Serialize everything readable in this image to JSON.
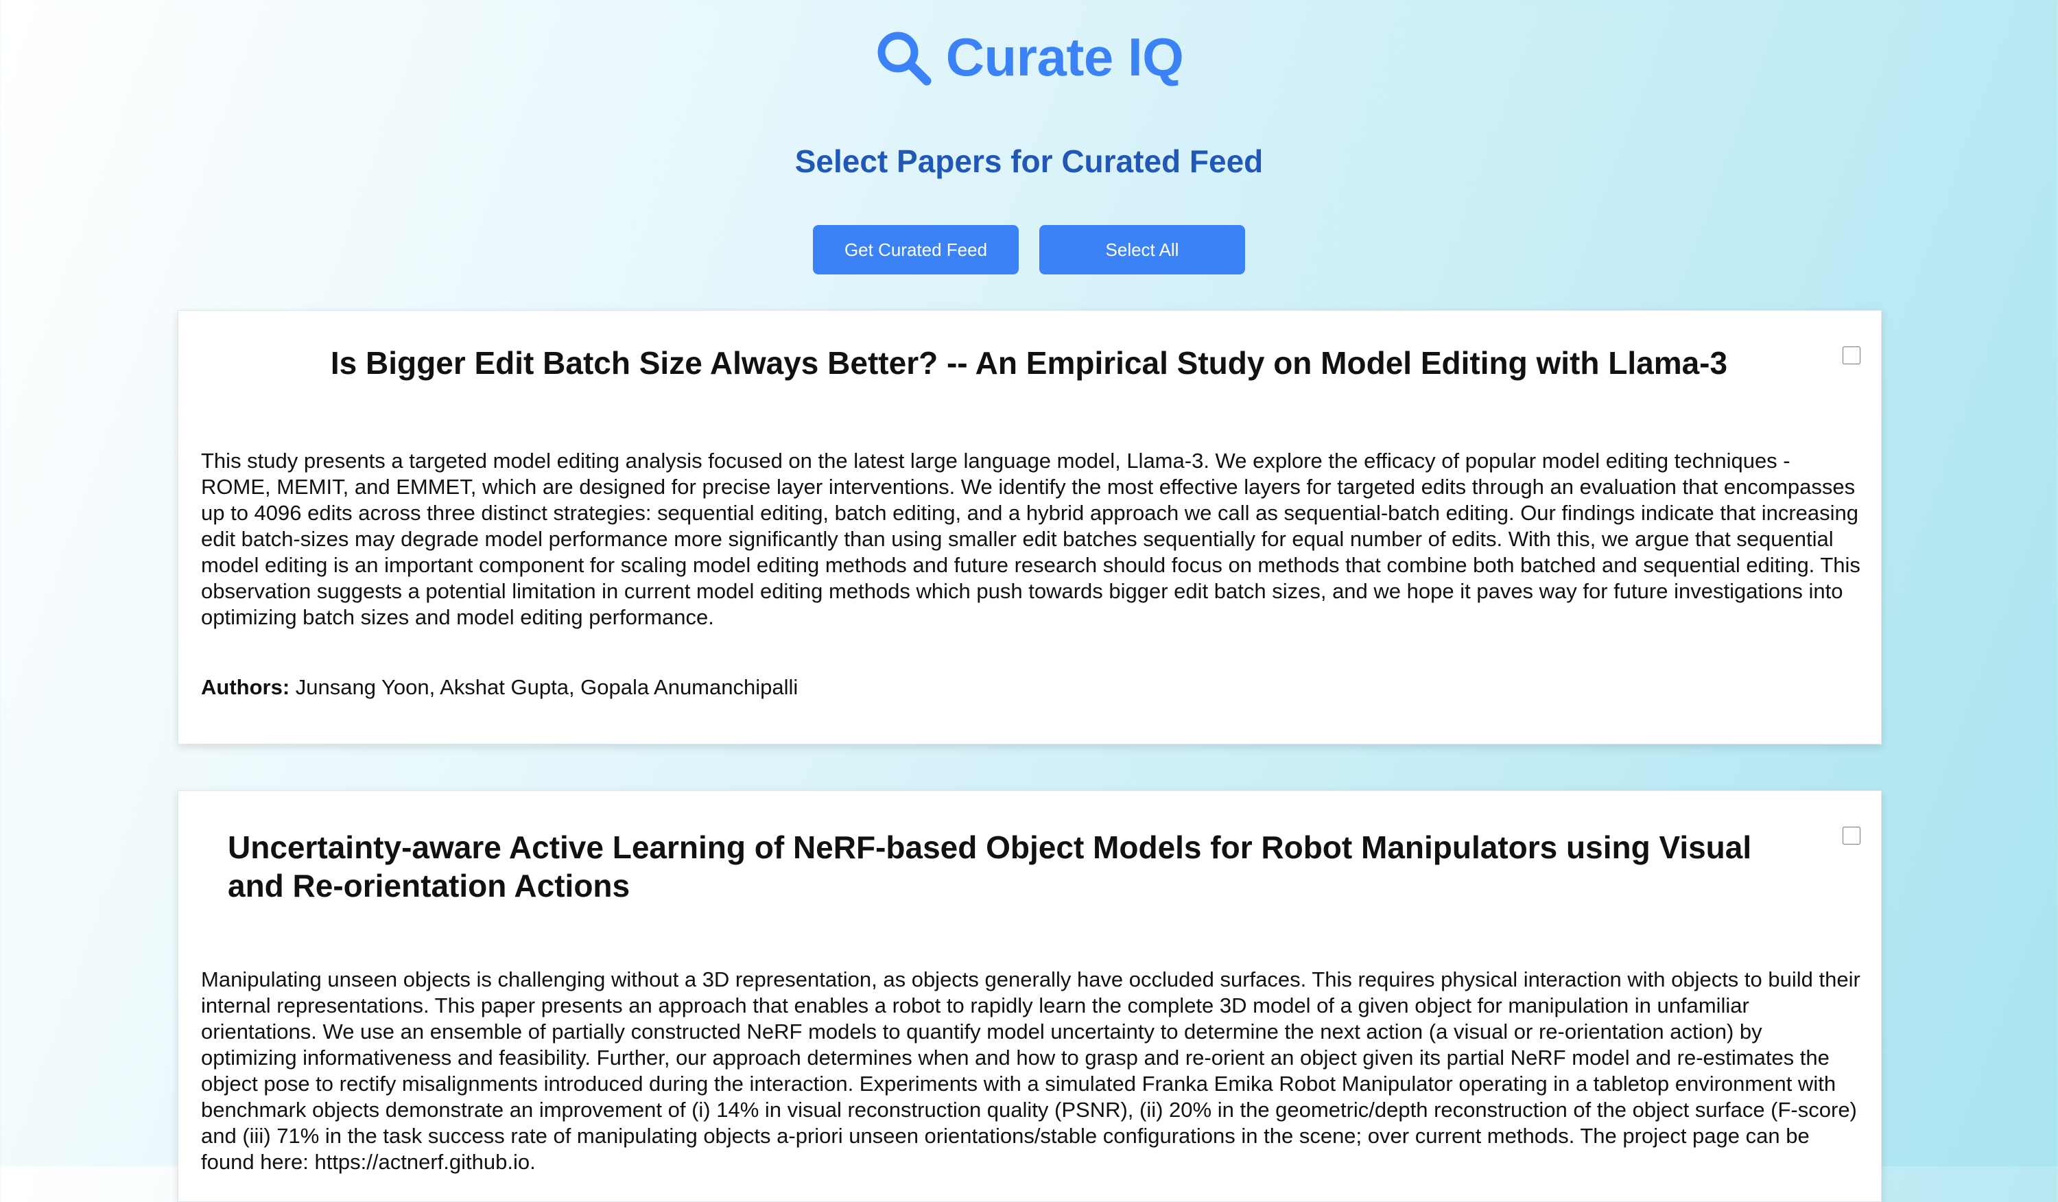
{
  "app": {
    "title": "Curate IQ",
    "logo_icon": "search-icon",
    "accent_color": "#3b82f6"
  },
  "page": {
    "heading": "Select Papers for Curated Feed"
  },
  "actions": {
    "get_feed_label": "Get Curated Feed",
    "select_all_label": "Select All"
  },
  "papers": [
    {
      "title": "Is Bigger Edit Batch Size Always Better? -- An Empirical Study on Model Editing with Llama-3",
      "abstract": "This study presents a targeted model editing analysis focused on the latest large language model, Llama-3. We explore the efficacy of popular model editing techniques - ROME, MEMIT, and EMMET, which are designed for precise layer interventions. We identify the most effective layers for targeted edits through an evaluation that encompasses up to 4096 edits across three distinct strategies: sequential editing, batch editing, and a hybrid approach we call as sequential-batch editing. Our findings indicate that increasing edit batch-sizes may degrade model performance more significantly than using smaller edit batches sequentially for equal number of edits. With this, we argue that sequential model editing is an important component for scaling model editing methods and future research should focus on methods that combine both batched and sequential editing. This observation suggests a potential limitation in current model editing methods which push towards bigger edit batch sizes, and we hope it paves way for future investigations into optimizing batch sizes and model editing performance.",
      "authors_label": "Authors:",
      "authors": "Junsang Yoon, Akshat Gupta, Gopala Anumanchipalli",
      "selected": false
    },
    {
      "title": "Uncertainty-aware Active Learning of NeRF-based Object Models for Robot Manipulators using Visual and Re-orientation Actions",
      "abstract": "Manipulating unseen objects is challenging without a 3D representation, as objects generally have occluded surfaces. This requires physical interaction with objects to build their internal representations. This paper presents an approach that enables a robot to rapidly learn the complete 3D model of a given object for manipulation in unfamiliar orientations. We use an ensemble of partially constructed NeRF models to quantify model uncertainty to determine the next action (a visual or re-orientation action) by optimizing informativeness and feasibility. Further, our approach determines when and how to grasp and re-orient an object given its partial NeRF model and re-estimates the object pose to rectify misalignments introduced during the interaction. Experiments with a simulated Franka Emika Robot Manipulator operating in a tabletop environment with benchmark objects demonstrate an improvement of (i) 14% in visual reconstruction quality (PSNR), (ii) 20% in the geometric/depth reconstruction of the object surface (F-score) and (iii) 71% in the task success rate of manipulating objects a-priori unseen orientations/stable configurations in the scene; over current methods. The project page can be found here: https://actnerf.github.io.",
      "selected": false
    }
  ]
}
